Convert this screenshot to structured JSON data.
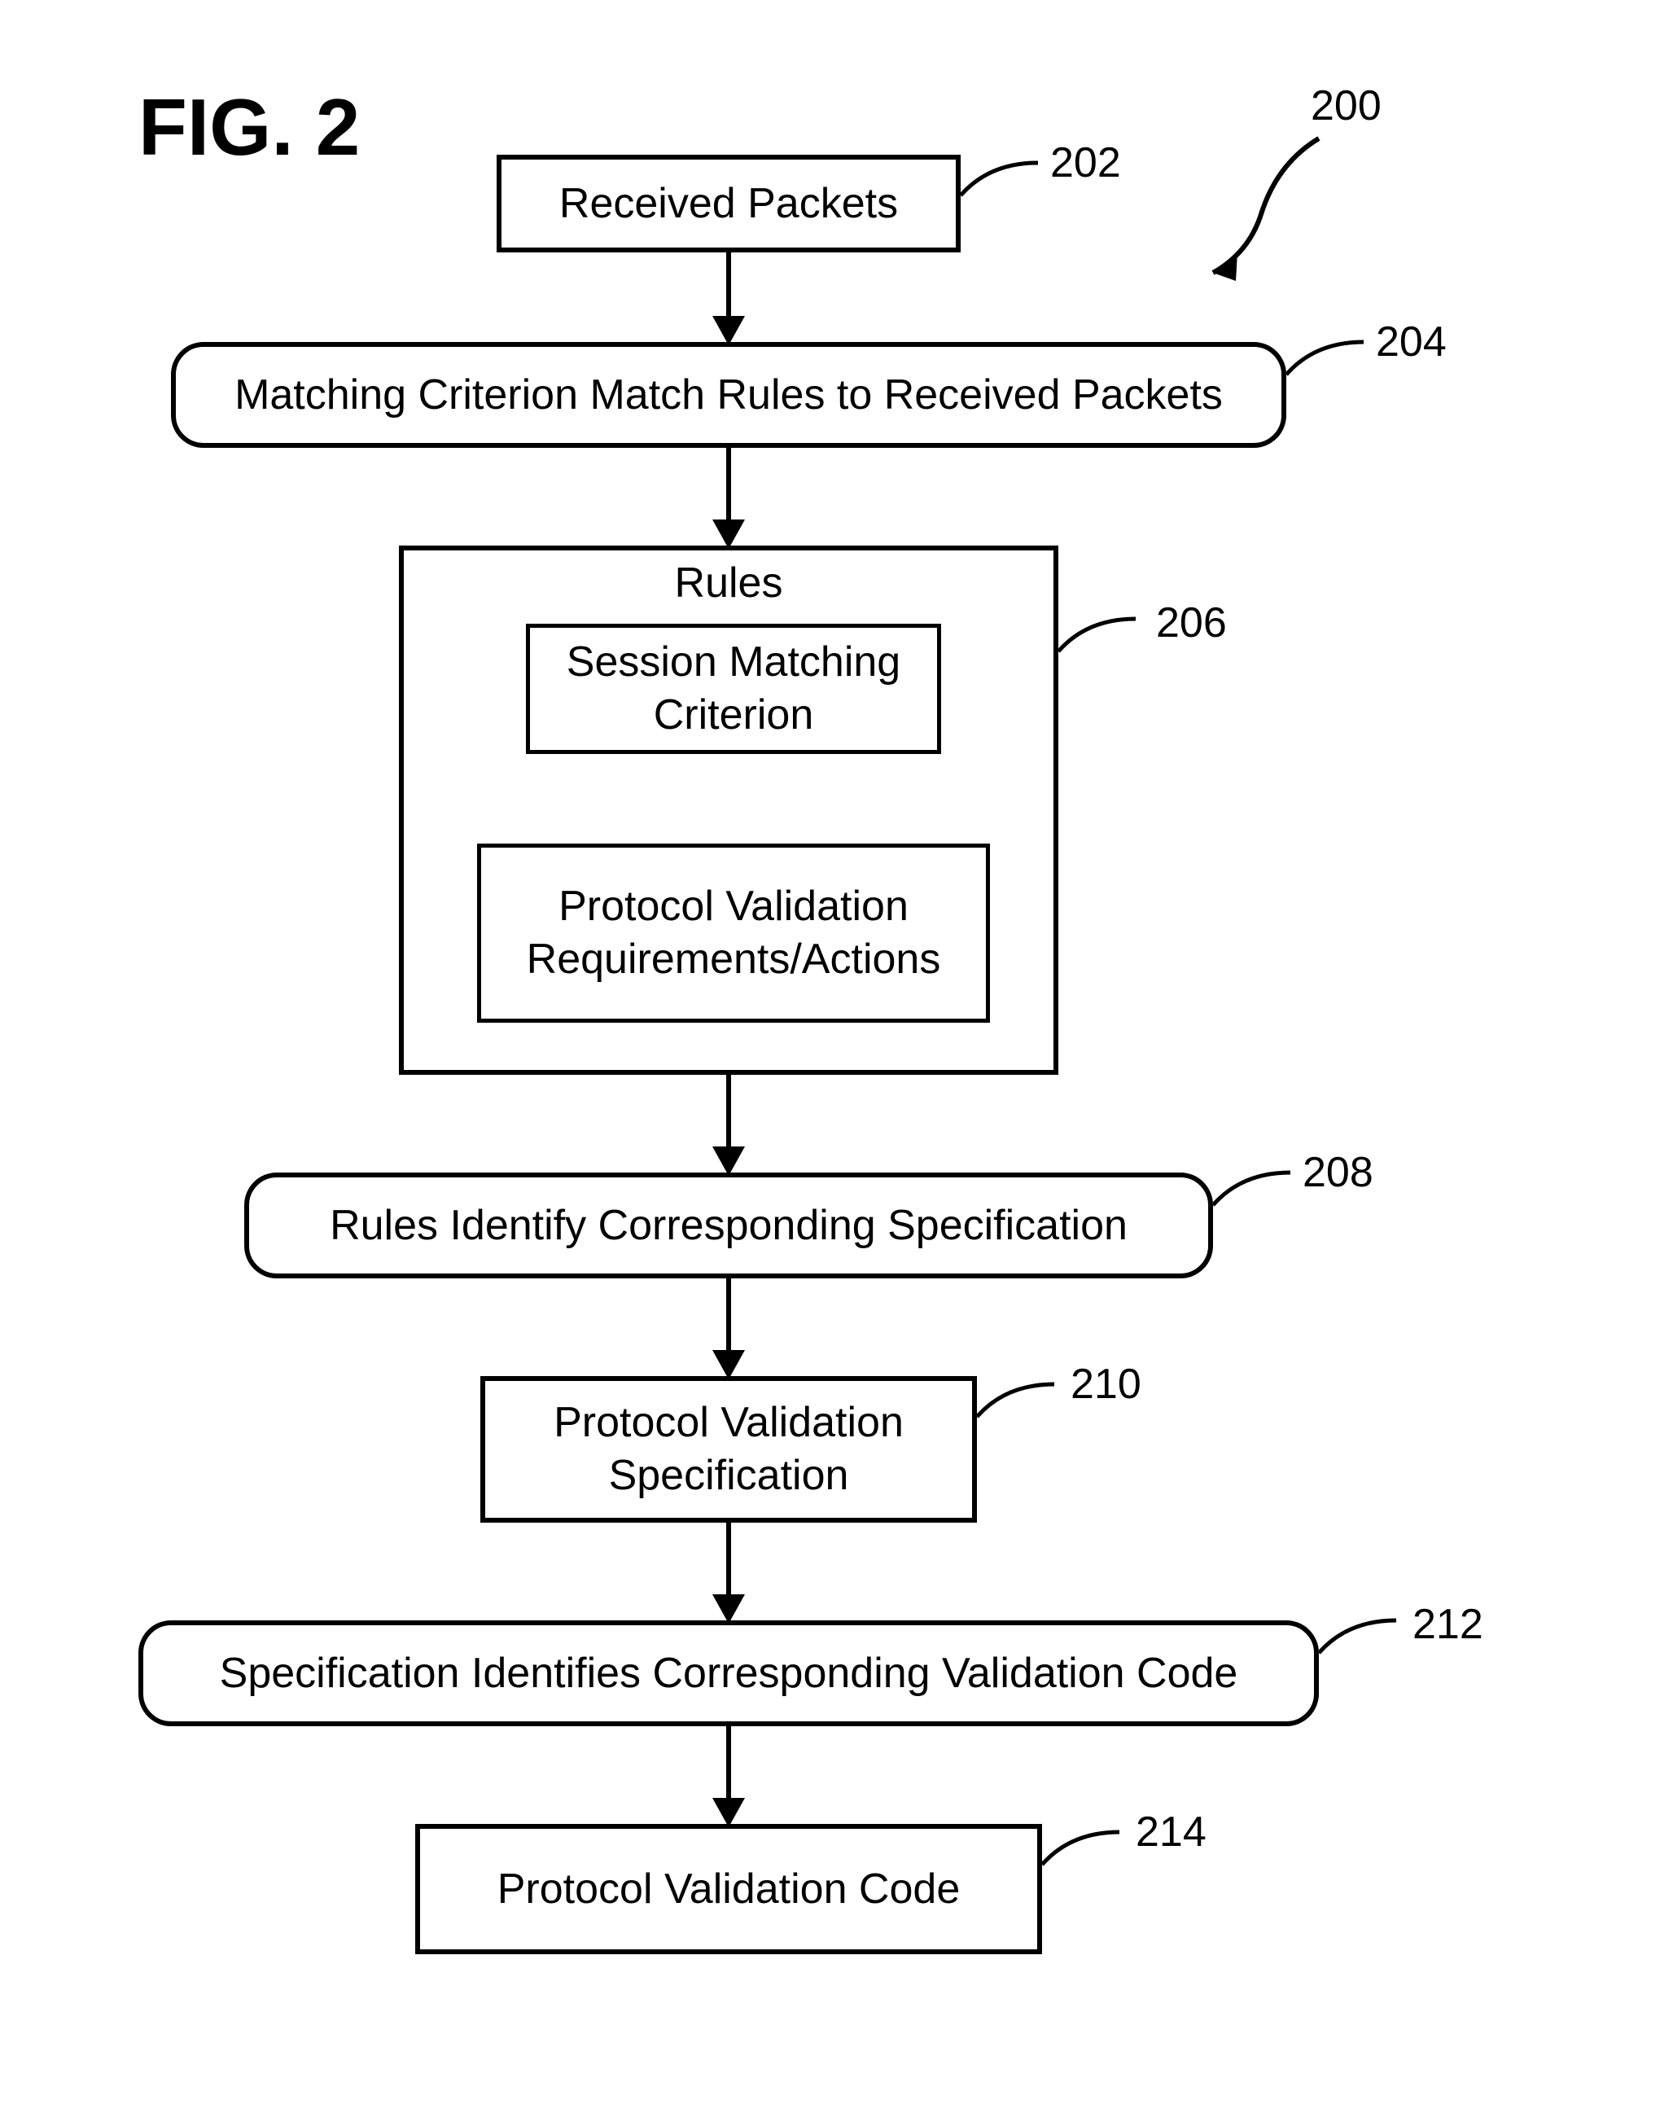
{
  "figure_label": "FIG. 2",
  "callouts": {
    "c200": "200",
    "c202": "202",
    "c204": "204",
    "c206": "206",
    "c208": "208",
    "c210": "210",
    "c212": "212",
    "c214": "214"
  },
  "boxes": {
    "b202": "Received Packets",
    "b204": "Matching Criterion Match Rules to Received Packets",
    "rules_title": "Rules",
    "session_matching": "Session Matching\nCriterion",
    "protocol_actions": "Protocol Validation\nRequirements/Actions",
    "b208": "Rules Identify Corresponding Specification",
    "b210": "Protocol Validation\nSpecification",
    "b212": "Specification Identifies Corresponding Validation Code",
    "b214": "Protocol Validation Code"
  }
}
